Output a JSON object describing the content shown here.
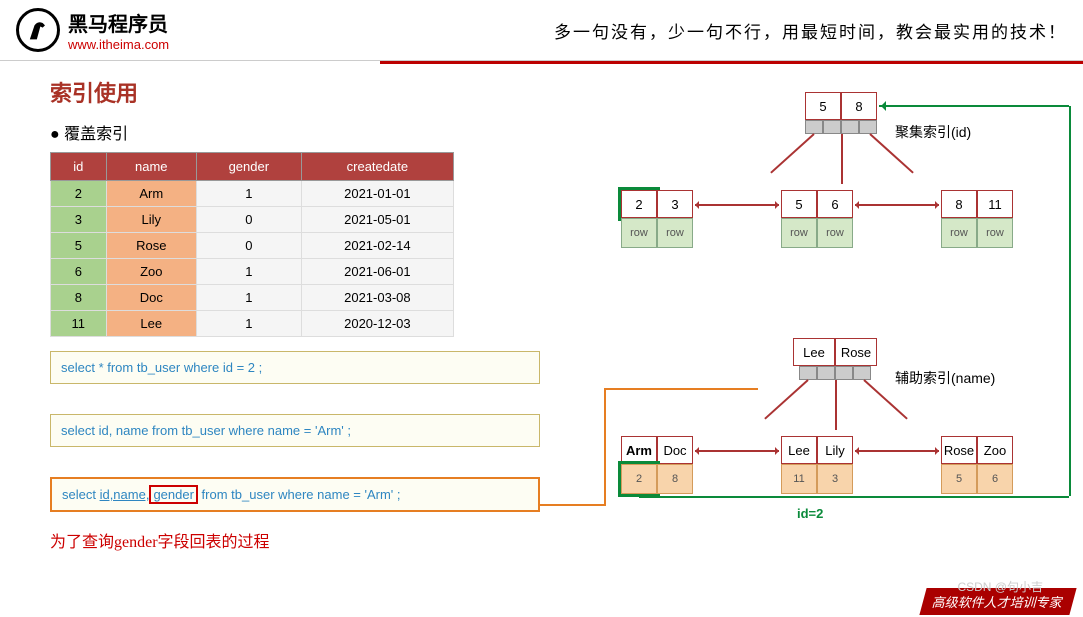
{
  "header": {
    "brand_cn": "黑马程序员",
    "brand_url": "www.itheima.com",
    "slogan": "多一句没有，少一句不行，用最短时间，教会最实用的技术！"
  },
  "page": {
    "title": "索引使用",
    "subtitle": "覆盖索引"
  },
  "table": {
    "headers": [
      "id",
      "name",
      "gender",
      "createdate"
    ],
    "rows": [
      {
        "id": "2",
        "name": "Arm",
        "gender": "1",
        "date": "2021-01-01"
      },
      {
        "id": "3",
        "name": "Lily",
        "gender": "0",
        "date": "2021-05-01"
      },
      {
        "id": "5",
        "name": "Rose",
        "gender": "0",
        "date": "2021-02-14"
      },
      {
        "id": "6",
        "name": "Zoo",
        "gender": "1",
        "date": "2021-06-01"
      },
      {
        "id": "8",
        "name": "Doc",
        "gender": "1",
        "date": "2021-03-08"
      },
      {
        "id": "11",
        "name": "Lee",
        "gender": "1",
        "date": "2020-12-03"
      }
    ]
  },
  "sql": {
    "q1": "select * from tb_user where id = 2 ;",
    "q2": "select  id, name from tb_user where name = 'Arm' ;",
    "q3_pre": "select ",
    "q3_cols": "id,name,",
    "q3_gender": "gender",
    "q3_post": " from tb_user where name = 'Arm' ;"
  },
  "note": "为了查询gender字段回表的过程",
  "tree1": {
    "label": "聚集索引(id)",
    "root": [
      "5",
      "8"
    ],
    "leaves": [
      {
        "keys": [
          "2",
          "3"
        ],
        "data": [
          "row",
          "row"
        ]
      },
      {
        "keys": [
          "5",
          "6"
        ],
        "data": [
          "row",
          "row"
        ]
      },
      {
        "keys": [
          "8",
          "11"
        ],
        "data": [
          "row",
          "row"
        ]
      }
    ]
  },
  "tree2": {
    "label": "辅助索引(name)",
    "root": [
      "Lee",
      "Rose"
    ],
    "leaves": [
      {
        "keys": [
          "Arm",
          "Doc"
        ],
        "data": [
          "2",
          "8"
        ]
      },
      {
        "keys": [
          "Lee",
          "Lily"
        ],
        "data": [
          "11",
          "3"
        ]
      },
      {
        "keys": [
          "Rose",
          "Zoo"
        ],
        "data": [
          "5",
          "6"
        ]
      }
    ],
    "result_label": "id=2"
  },
  "footer": "高级软件人才培训专家",
  "watermark": "CSDN @句小吉"
}
